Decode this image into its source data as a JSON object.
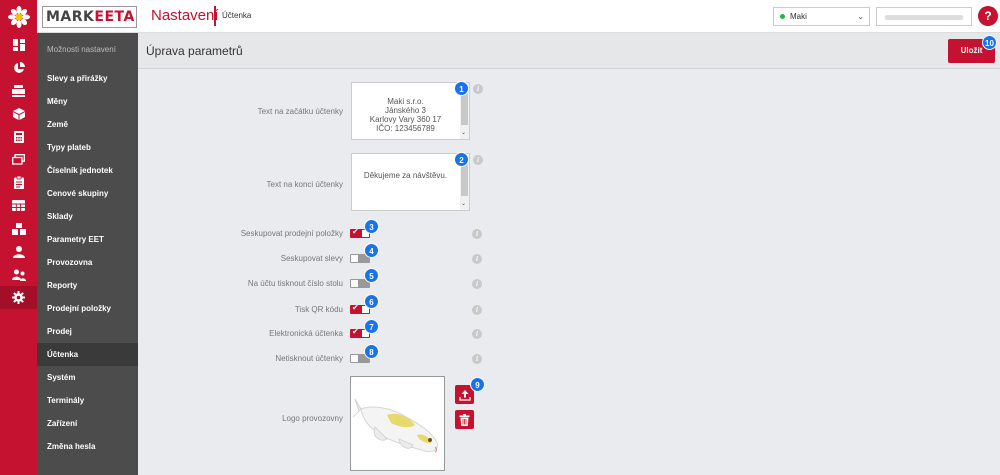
{
  "header": {
    "logo_text": "MARKEETA",
    "section_title": "Nastavení",
    "page_title": "Účtenka",
    "shop_select": "Maki",
    "help": "?"
  },
  "sidebar": {
    "header": "Možnosti nastavení",
    "items": [
      {
        "label": "Slevy a přirážky"
      },
      {
        "label": "Měny"
      },
      {
        "label": "Země"
      },
      {
        "label": "Typy plateb"
      },
      {
        "label": "Číselník jednotek"
      },
      {
        "label": "Cenové skupiny"
      },
      {
        "label": "Sklady"
      },
      {
        "label": "Parametry EET"
      },
      {
        "label": "Provozovna"
      },
      {
        "label": "Reporty"
      },
      {
        "label": "Prodejní položky"
      },
      {
        "label": "Prodej"
      },
      {
        "label": "Účtenka"
      },
      {
        "label": "Systém"
      },
      {
        "label": "Terminály"
      },
      {
        "label": "Zařízení"
      },
      {
        "label": "Změna hesla"
      }
    ],
    "active_index": 12
  },
  "iconbar": [
    "dashboard-icon",
    "pie-chart-icon",
    "register-icon",
    "box-icon",
    "calculator-icon",
    "cards-icon",
    "clipboard-icon",
    "inventory-icon",
    "boxes-icon",
    "user-icon",
    "users-icon",
    "gear-icon"
  ],
  "main": {
    "title": "Úprava parametrů",
    "save_label": "Uložit",
    "save_badge": "10",
    "header_text": {
      "label": "Text na začátku účtenky",
      "value": "Maki s.r.o.\nJánského 3\nKarlovy Vary 360 17\nIČO: 123456789",
      "badge": "1"
    },
    "footer_text": {
      "label": "Text na konci účtenky",
      "value": "Děkujeme za návštěvu.",
      "badge": "2"
    },
    "toggles": [
      {
        "label": "Seskupovat prodejní položky",
        "on": true,
        "badge": "3"
      },
      {
        "label": "Seskupovat slevy",
        "on": false,
        "badge": "4"
      },
      {
        "label": "Na účtu tisknout číslo stolu",
        "on": false,
        "badge": "5"
      },
      {
        "label": "Tisk QR kódu",
        "on": true,
        "badge": "6"
      },
      {
        "label": "Elektronická účtenka",
        "on": true,
        "badge": "7"
      },
      {
        "label": "Netisknout účtenky",
        "on": false,
        "badge": "8"
      }
    ],
    "logo": {
      "label": "Logo provozovny",
      "badge": "9"
    },
    "info_glyph": "i"
  },
  "colors": {
    "accent": "#c41230",
    "badge": "#1a73e8",
    "sidebar": "#4c4c4c"
  }
}
